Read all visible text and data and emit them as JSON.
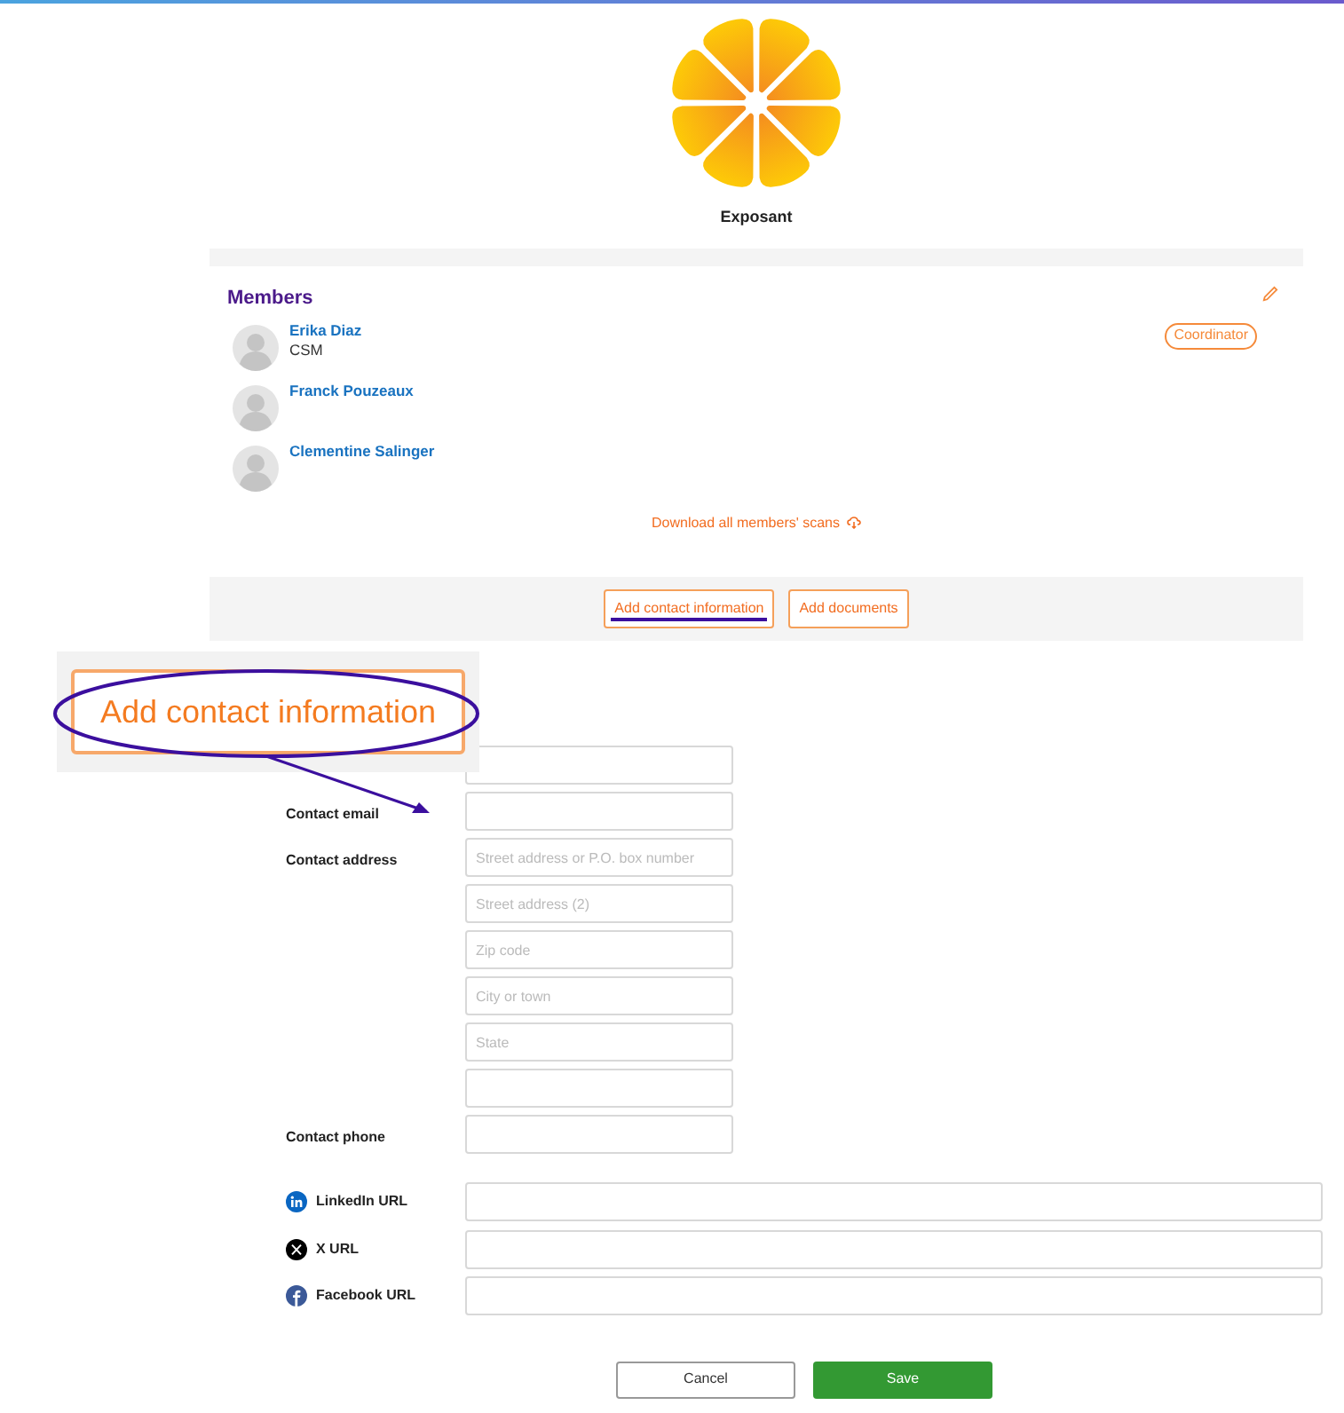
{
  "profile": {
    "name": "Exposant"
  },
  "members": {
    "title": "Members",
    "items": [
      {
        "name": "Erika Diaz",
        "role": "CSM",
        "badge": "Coordinator"
      },
      {
        "name": "Franck Pouzeaux"
      },
      {
        "name": "Clementine Salinger"
      }
    ],
    "download_link": "Download all members' scans"
  },
  "actions": [
    {
      "label": "Add contact information",
      "highlighted": true
    },
    {
      "label": "Add documents",
      "highlighted": false
    }
  ],
  "callout": {
    "label": "Add contact information"
  },
  "form": {
    "fields": [
      {
        "kind": "field"
      },
      {
        "kind": "field",
        "label": "Contact email"
      },
      {
        "kind": "field",
        "label": "Contact address",
        "placeholder": "Street address or P.O. box number"
      },
      {
        "kind": "field",
        "placeholder": "Street address (2)"
      },
      {
        "kind": "field",
        "placeholder": "Zip code"
      },
      {
        "kind": "field",
        "placeholder": "City or town"
      },
      {
        "kind": "field",
        "placeholder": "State"
      },
      {
        "kind": "field"
      },
      {
        "kind": "field",
        "label": "Contact phone"
      }
    ],
    "social": [
      {
        "kind": "linkedin",
        "label": "LinkedIn URL"
      },
      {
        "kind": "x",
        "label": "X URL"
      },
      {
        "kind": "facebook",
        "label": "Facebook URL"
      }
    ],
    "buttons": [
      {
        "kind": "secondary",
        "label": "Cancel"
      },
      {
        "kind": "primary",
        "label": "Save"
      }
    ]
  }
}
